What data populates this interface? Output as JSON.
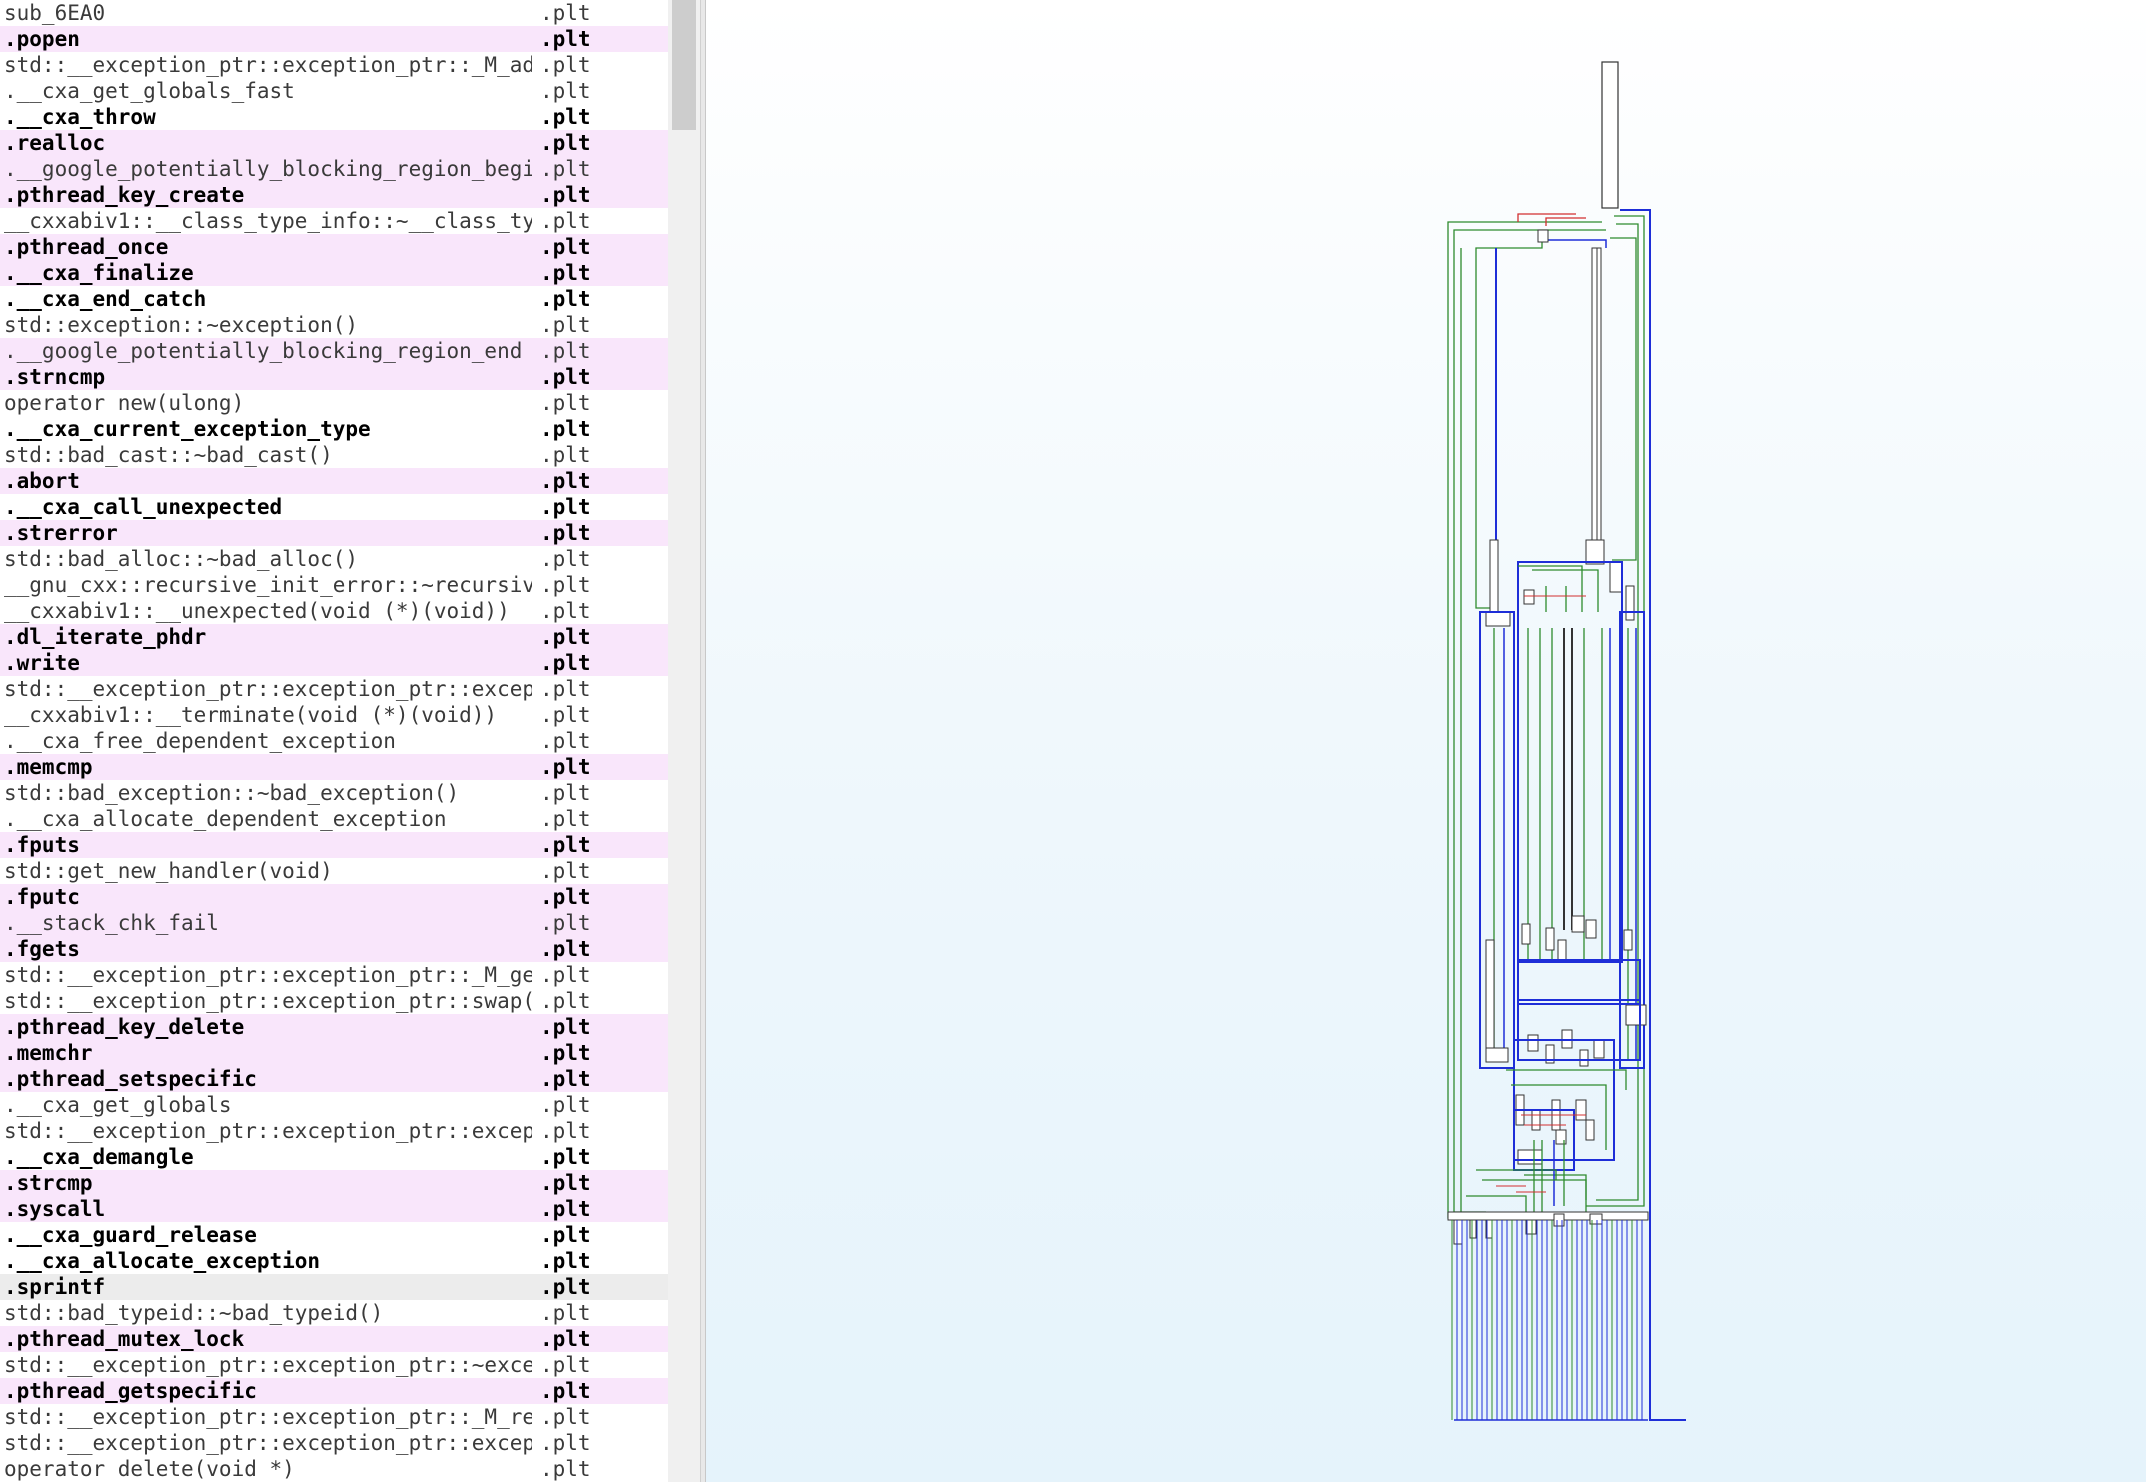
{
  "functions_list": {
    "rows": [
      {
        "name": "sub_6EA0",
        "segment": ".plt",
        "bold": false,
        "highlight": false
      },
      {
        "name": ".popen",
        "segment": ".plt",
        "bold": true,
        "highlight": true
      },
      {
        "name": "std::__exception_ptr::exception_ptr::_M_ad⋯",
        "segment": ".plt",
        "bold": false,
        "highlight": false
      },
      {
        "name": ".__cxa_get_globals_fast",
        "segment": ".plt",
        "bold": false,
        "highlight": false
      },
      {
        "name": ".__cxa_throw",
        "segment": ".plt",
        "bold": true,
        "highlight": false
      },
      {
        "name": ".realloc",
        "segment": ".plt",
        "bold": true,
        "highlight": true
      },
      {
        "name": ".__google_potentially_blocking_region_begin",
        "segment": ".plt",
        "bold": false,
        "highlight": true
      },
      {
        "name": ".pthread_key_create",
        "segment": ".plt",
        "bold": true,
        "highlight": true
      },
      {
        "name": "__cxxabiv1::__class_type_info::~__class_ty⋯",
        "segment": ".plt",
        "bold": false,
        "highlight": false
      },
      {
        "name": ".pthread_once",
        "segment": ".plt",
        "bold": true,
        "highlight": true
      },
      {
        "name": ".__cxa_finalize",
        "segment": ".plt",
        "bold": true,
        "highlight": true
      },
      {
        "name": ".__cxa_end_catch",
        "segment": ".plt",
        "bold": true,
        "highlight": false
      },
      {
        "name": "std::exception::~exception()",
        "segment": ".plt",
        "bold": false,
        "highlight": false
      },
      {
        "name": ".__google_potentially_blocking_region_end",
        "segment": ".plt",
        "bold": false,
        "highlight": true
      },
      {
        "name": ".strncmp",
        "segment": ".plt",
        "bold": true,
        "highlight": true
      },
      {
        "name": "operator new(ulong)",
        "segment": ".plt",
        "bold": false,
        "highlight": false
      },
      {
        "name": ".__cxa_current_exception_type",
        "segment": ".plt",
        "bold": true,
        "highlight": false
      },
      {
        "name": "std::bad_cast::~bad_cast()",
        "segment": ".plt",
        "bold": false,
        "highlight": false
      },
      {
        "name": ".abort",
        "segment": ".plt",
        "bold": true,
        "highlight": true
      },
      {
        "name": ".__cxa_call_unexpected",
        "segment": ".plt",
        "bold": true,
        "highlight": false
      },
      {
        "name": ".strerror",
        "segment": ".plt",
        "bold": true,
        "highlight": true
      },
      {
        "name": "std::bad_alloc::~bad_alloc()",
        "segment": ".plt",
        "bold": false,
        "highlight": false
      },
      {
        "name": "__gnu_cxx::recursive_init_error::~recursiv⋯",
        "segment": ".plt",
        "bold": false,
        "highlight": false
      },
      {
        "name": "__cxxabiv1::__unexpected(void (*)(void))",
        "segment": ".plt",
        "bold": false,
        "highlight": false
      },
      {
        "name": ".dl_iterate_phdr",
        "segment": ".plt",
        "bold": true,
        "highlight": true
      },
      {
        "name": ".write",
        "segment": ".plt",
        "bold": true,
        "highlight": true
      },
      {
        "name": "std::__exception_ptr::exception_ptr::excep⋯",
        "segment": ".plt",
        "bold": false,
        "highlight": false
      },
      {
        "name": "__cxxabiv1::__terminate(void (*)(void))",
        "segment": ".plt",
        "bold": false,
        "highlight": false
      },
      {
        "name": ".__cxa_free_dependent_exception",
        "segment": ".plt",
        "bold": false,
        "highlight": false
      },
      {
        "name": ".memcmp",
        "segment": ".plt",
        "bold": true,
        "highlight": true
      },
      {
        "name": "std::bad_exception::~bad_exception()",
        "segment": ".plt",
        "bold": false,
        "highlight": false
      },
      {
        "name": ".__cxa_allocate_dependent_exception",
        "segment": ".plt",
        "bold": false,
        "highlight": false
      },
      {
        "name": ".fputs",
        "segment": ".plt",
        "bold": true,
        "highlight": true
      },
      {
        "name": "std::get_new_handler(void)",
        "segment": ".plt",
        "bold": false,
        "highlight": false
      },
      {
        "name": ".fputc",
        "segment": ".plt",
        "bold": true,
        "highlight": true
      },
      {
        "name": ".__stack_chk_fail",
        "segment": ".plt",
        "bold": false,
        "highlight": true
      },
      {
        "name": ".fgets",
        "segment": ".plt",
        "bold": true,
        "highlight": true
      },
      {
        "name": "std::__exception_ptr::exception_ptr::_M_ge⋯",
        "segment": ".plt",
        "bold": false,
        "highlight": false
      },
      {
        "name": "std::__exception_ptr::exception_ptr::swap(⋯",
        "segment": ".plt",
        "bold": false,
        "highlight": false
      },
      {
        "name": ".pthread_key_delete",
        "segment": ".plt",
        "bold": true,
        "highlight": true
      },
      {
        "name": ".memchr",
        "segment": ".plt",
        "bold": true,
        "highlight": true
      },
      {
        "name": ".pthread_setspecific",
        "segment": ".plt",
        "bold": true,
        "highlight": true
      },
      {
        "name": ".__cxa_get_globals",
        "segment": ".plt",
        "bold": false,
        "highlight": false
      },
      {
        "name": "std::__exception_ptr::exception_ptr::excep⋯",
        "segment": ".plt",
        "bold": false,
        "highlight": false
      },
      {
        "name": ".__cxa_demangle",
        "segment": ".plt",
        "bold": true,
        "highlight": false
      },
      {
        "name": ".strcmp",
        "segment": ".plt",
        "bold": true,
        "highlight": true
      },
      {
        "name": ".syscall",
        "segment": ".plt",
        "bold": true,
        "highlight": true
      },
      {
        "name": ".__cxa_guard_release",
        "segment": ".plt",
        "bold": true,
        "highlight": false
      },
      {
        "name": ".__cxa_allocate_exception",
        "segment": ".plt",
        "bold": true,
        "highlight": false
      },
      {
        "name": ".sprintf",
        "segment": ".plt",
        "bold": true,
        "highlight": false,
        "selected": true
      },
      {
        "name": "std::bad_typeid::~bad_typeid()",
        "segment": ".plt",
        "bold": false,
        "highlight": false
      },
      {
        "name": ".pthread_mutex_lock",
        "segment": ".plt",
        "bold": true,
        "highlight": true
      },
      {
        "name": "std::__exception_ptr::exception_ptr::~exce⋯",
        "segment": ".plt",
        "bold": false,
        "highlight": false
      },
      {
        "name": ".pthread_getspecific",
        "segment": ".plt",
        "bold": true,
        "highlight": true
      },
      {
        "name": "std::__exception_ptr::exception_ptr::_M_re⋯",
        "segment": ".plt",
        "bold": false,
        "highlight": false
      },
      {
        "name": "std::__exception_ptr::exception_ptr::excep⋯",
        "segment": ".plt",
        "bold": false,
        "highlight": false
      },
      {
        "name": "operator delete(void *)",
        "segment": ".plt",
        "bold": false,
        "highlight": false
      }
    ]
  },
  "graph_view": {
    "kind": "function-flow-graph-overview",
    "edge_colors": {
      "conditional_true": "#2e8b2e",
      "conditional_false": "#d23030",
      "unconditional": "#1e2ed8"
    },
    "node_color": "#ffffff",
    "node_border": "#333333"
  },
  "colors": {
    "row_highlight": "#f9e6fb",
    "row_selected": "#ececec",
    "scrollbar_track": "#f0f0f0",
    "scrollbar_thumb": "#cdcdcd",
    "graph_bg_top": "#ffffff",
    "graph_bg_bottom": "#e5f3fb"
  }
}
